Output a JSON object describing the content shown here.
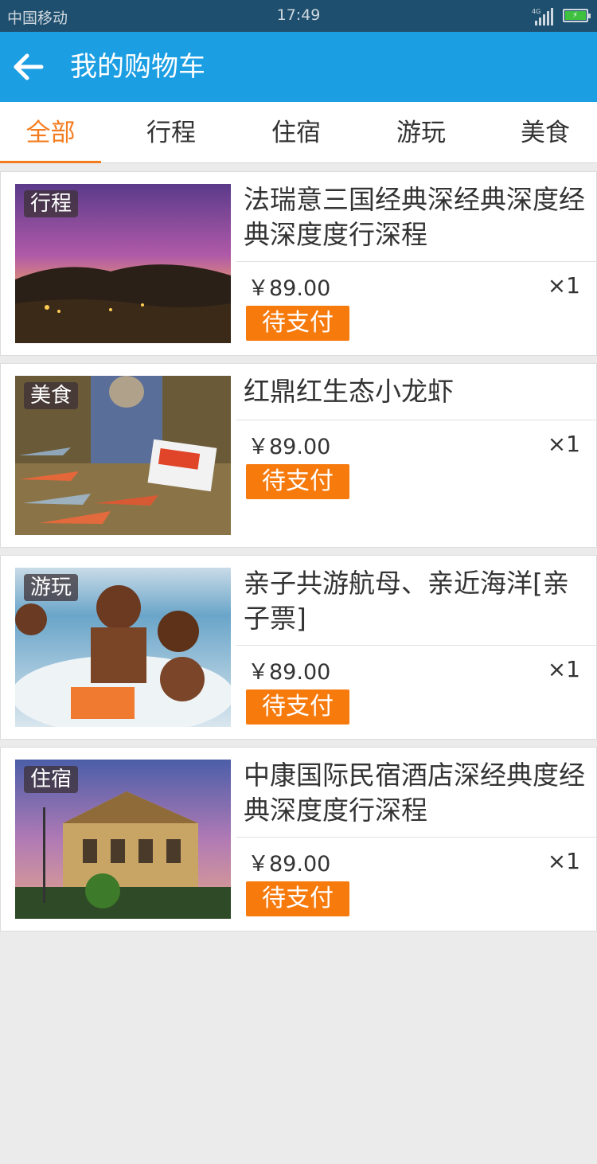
{
  "status_bar": {
    "carrier": "中国移动",
    "time": "17:49",
    "network": "4G",
    "battery_icon": "battery-charging-icon"
  },
  "app_bar": {
    "back_icon": "arrow-left-icon",
    "title": "我的购物车",
    "background": "#1c9ee3"
  },
  "tabs": [
    {
      "label": "全部",
      "active": true
    },
    {
      "label": "行程",
      "active": false
    },
    {
      "label": "住宿",
      "active": false
    },
    {
      "label": "游玩",
      "active": false
    },
    {
      "label": "美食",
      "active": false
    }
  ],
  "accent_color": "#f47c1f",
  "items": [
    {
      "category": "行程",
      "name": "法瑞意三国经典深经典深度经典深度度行深程",
      "price": "￥89.00",
      "quantity": "×1",
      "status": "待支付"
    },
    {
      "category": "美食",
      "name": "红鼎红生态小龙虾",
      "price": "￥89.00",
      "quantity": "×1",
      "status": "待支付"
    },
    {
      "category": "游玩",
      "name": "亲子共游航母、亲近海洋[亲子票]",
      "price": "￥89.00",
      "quantity": "×1",
      "status": "待支付"
    },
    {
      "category": "住宿",
      "name": "中康国际民宿酒店深经典度经典深度度行深程",
      "price": "￥89.00",
      "quantity": "×1",
      "status": "待支付"
    }
  ]
}
